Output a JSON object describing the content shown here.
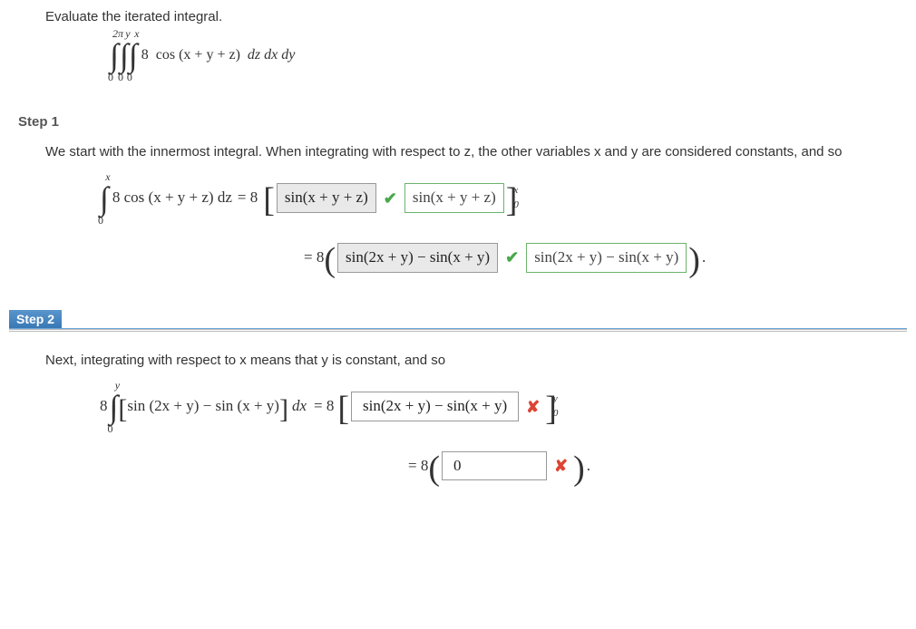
{
  "problem": {
    "prompt": "Evaluate the iterated integral.",
    "int_bounds": {
      "outer_upper": "2π",
      "outer_lower": "0",
      "middle_upper": "y",
      "middle_lower": "0",
      "inner_upper": "x",
      "inner_lower": "0"
    },
    "integrand_coef": "8",
    "integrand_body": "cos (x + y + z)",
    "diffs": "dz dx dy"
  },
  "step1": {
    "label": "Step 1",
    "text": "We start with the innermost integral. When integrating with respect to z, the other variables x and y are considered constants, and so",
    "row1_lhs_upper": "x",
    "row1_lhs_lower": "0",
    "row1_lhs_integrand": "8 cos (x + y + z) dz",
    "row1_eq": "= 8",
    "row1_box_student": "sin(x + y + z)",
    "row1_box_correct": "sin(x + y + z)",
    "row1_bounds_upper": "x",
    "row1_bounds_lower": "0",
    "row2_eq": "= 8",
    "row2_box_student": "sin(2x + y) − sin(x + y)",
    "row2_box_correct": "sin(2x + y) − sin(x + y)",
    "row2_period": "."
  },
  "step2": {
    "label": "Step 2",
    "text": "Next, integrating with respect to x means that y is constant, and so",
    "row1_coef": "8",
    "row1_upper": "y",
    "row1_lower": "0",
    "row1_integrand": "sin (2x + y) − sin (x + y)",
    "row1_dx": "dx",
    "row1_eq": "= 8",
    "row1_box_student": "sin(2x + y) − sin(x + y)",
    "row1_bounds_upper": "y",
    "row1_bounds_lower": "0",
    "row2_eq": "= 8",
    "row2_box_student": "0",
    "row2_period": "."
  }
}
